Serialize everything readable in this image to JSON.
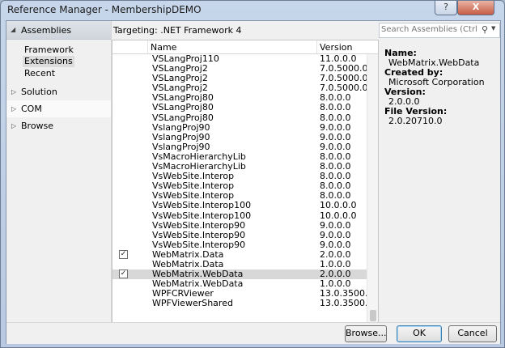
{
  "window": {
    "title": "Reference Manager - MembershipDEMO",
    "help_label": "?",
    "close_label": "X"
  },
  "nav": {
    "header": "Assemblies",
    "sub_items": [
      {
        "label": "Framework",
        "selected": false
      },
      {
        "label": "Extensions",
        "selected": true
      },
      {
        "label": "Recent",
        "selected": false
      }
    ],
    "groups": [
      {
        "label": "Solution"
      },
      {
        "label": "COM"
      },
      {
        "label": "Browse"
      }
    ]
  },
  "targeting": "Targeting: .NET Framework 4",
  "search": {
    "placeholder": "Search Assemblies (Ctrl+E)"
  },
  "table": {
    "columns": [
      "Name",
      "Version"
    ],
    "rows": [
      {
        "name": "VSLangProj110",
        "version": "11.0.0.0",
        "checked": false
      },
      {
        "name": "VSLangProj2",
        "version": "7.0.5000.0",
        "checked": false
      },
      {
        "name": "VSLangProj2",
        "version": "7.0.5000.0",
        "checked": false
      },
      {
        "name": "VSLangProj2",
        "version": "7.0.5000.0",
        "checked": false
      },
      {
        "name": "VSLangProj80",
        "version": "8.0.0.0",
        "checked": false
      },
      {
        "name": "VSLangProj80",
        "version": "8.0.0.0",
        "checked": false
      },
      {
        "name": "VSLangProj80",
        "version": "8.0.0.0",
        "checked": false
      },
      {
        "name": "VslangProj90",
        "version": "9.0.0.0",
        "checked": false
      },
      {
        "name": "VslangProj90",
        "version": "9.0.0.0",
        "checked": false
      },
      {
        "name": "VslangProj90",
        "version": "9.0.0.0",
        "checked": false
      },
      {
        "name": "VsMacroHierarchyLib",
        "version": "8.0.0.0",
        "checked": false
      },
      {
        "name": "VsMacroHierarchyLib",
        "version": "8.0.0.0",
        "checked": false
      },
      {
        "name": "VsWebSite.Interop",
        "version": "8.0.0.0",
        "checked": false
      },
      {
        "name": "VsWebSite.Interop",
        "version": "8.0.0.0",
        "checked": false
      },
      {
        "name": "VsWebSite.Interop",
        "version": "8.0.0.0",
        "checked": false
      },
      {
        "name": "VsWebSite.Interop100",
        "version": "10.0.0.0",
        "checked": false
      },
      {
        "name": "VsWebSite.Interop100",
        "version": "10.0.0.0",
        "checked": false
      },
      {
        "name": "VsWebSite.Interop90",
        "version": "9.0.0.0",
        "checked": false
      },
      {
        "name": "VsWebSite.Interop90",
        "version": "9.0.0.0",
        "checked": false
      },
      {
        "name": "VsWebSite.Interop90",
        "version": "9.0.0.0",
        "checked": false
      },
      {
        "name": "WebMatrix.Data",
        "version": "2.0.0.0",
        "checked": true
      },
      {
        "name": "WebMatrix.Data",
        "version": "1.0.0.0",
        "checked": false
      },
      {
        "name": "WebMatrix.WebData",
        "version": "2.0.0.0",
        "checked": true,
        "selected": true
      },
      {
        "name": "WebMatrix.WebData",
        "version": "1.0.0.0",
        "checked": false
      },
      {
        "name": "WPFCRViewer",
        "version": "13.0.3500.0",
        "checked": false
      },
      {
        "name": "WPFViewerShared",
        "version": "13.0.3500.0",
        "checked": false
      }
    ]
  },
  "details": {
    "name_label": "Name:",
    "name_value": "WebMatrix.WebData",
    "created_label": "Created by:",
    "created_value": "Microsoft Corporation",
    "version_label": "Version:",
    "version_value": "2.0.0.0",
    "file_version_label": "File Version:",
    "file_version_value": "2.0.20710.0"
  },
  "buttons": {
    "browse": "Browse...",
    "ok": "OK",
    "cancel": "Cancel"
  },
  "check_glyph": "✓",
  "icons": {
    "expanded": "triangle-down-icon",
    "collapsed": "triangle-right-icon",
    "search": "magnifier-icon",
    "dropdown": "chevron-down-icon"
  }
}
